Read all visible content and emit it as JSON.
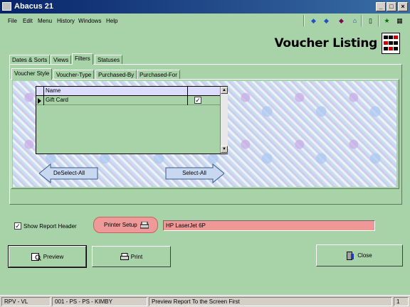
{
  "window": {
    "title": "Abacus 21"
  },
  "menu": [
    "File",
    "Edit",
    "Menu",
    "History",
    "Windows",
    "Help"
  ],
  "toolbar_icons": [
    "arrow-left-icon",
    "arrow-right-icon",
    "gem-icon",
    "home-icon",
    "calculator-icon",
    "grid-icon",
    "runner-icon",
    "apps-icon"
  ],
  "header": {
    "title": "Voucher Listing"
  },
  "tabs": [
    "Dates & Sorts",
    "Views",
    "Filters",
    "Statuses"
  ],
  "active_tab": "Filters",
  "subtabs": [
    "Voucher Style",
    "Voucher-Type",
    "Purchased-By",
    "Purchased-For"
  ],
  "active_subtab": "Voucher Style",
  "grid": {
    "columns": [
      "Name"
    ],
    "rows": [
      {
        "name": "Gift Card",
        "checked": true
      }
    ]
  },
  "buttons": {
    "deselect_all": "DeSelect-All",
    "select_all": "Select-All",
    "printer_setup": "Printer Setup",
    "preview": "Preview",
    "print": "Print",
    "close": "Close"
  },
  "options": {
    "show_report_header": "Show Report Header",
    "show_report_header_checked": true
  },
  "printer": {
    "name": "HP LaserJet 6P"
  },
  "status": {
    "code": "RPV - VL",
    "context": "001 - PS - PS - KIMBY",
    "hint": "Preview Report To the Screen First",
    "page": "1"
  },
  "colors": {
    "background": "#a8d2a8",
    "titlebar": "#08246b",
    "printer_field": "#f09898"
  }
}
